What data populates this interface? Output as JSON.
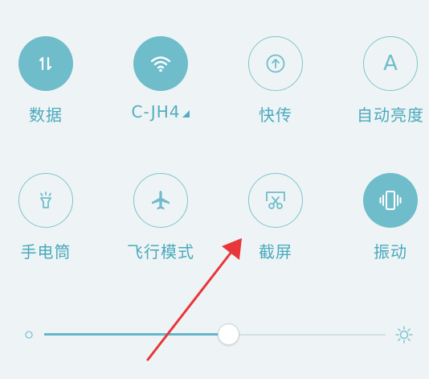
{
  "tiles": [
    {
      "label": "数据",
      "icon": "data-icon",
      "active": true
    },
    {
      "label": "C-JH4",
      "icon": "wifi-icon",
      "active": true
    },
    {
      "label": "快传",
      "icon": "quick-transfer-icon",
      "active": false
    },
    {
      "label": "自动亮度",
      "icon": "auto-brightness-icon",
      "active": false
    },
    {
      "label": "手电筒",
      "icon": "flashlight-icon",
      "active": false
    },
    {
      "label": "飞行模式",
      "icon": "airplane-icon",
      "active": false
    },
    {
      "label": "截屏",
      "icon": "screenshot-icon",
      "active": false
    },
    {
      "label": "振动",
      "icon": "vibrate-icon",
      "active": true
    }
  ],
  "brightness": {
    "level": 0.54,
    "low_icon": "brightness-low-icon",
    "high_icon": "brightness-high-icon"
  },
  "auto_brightness_glyph": "A",
  "colors": {
    "accent": "#6fbccb",
    "label": "#4aa9bd",
    "background": "#eef4f5",
    "annotation_arrow": "#e8363a"
  }
}
